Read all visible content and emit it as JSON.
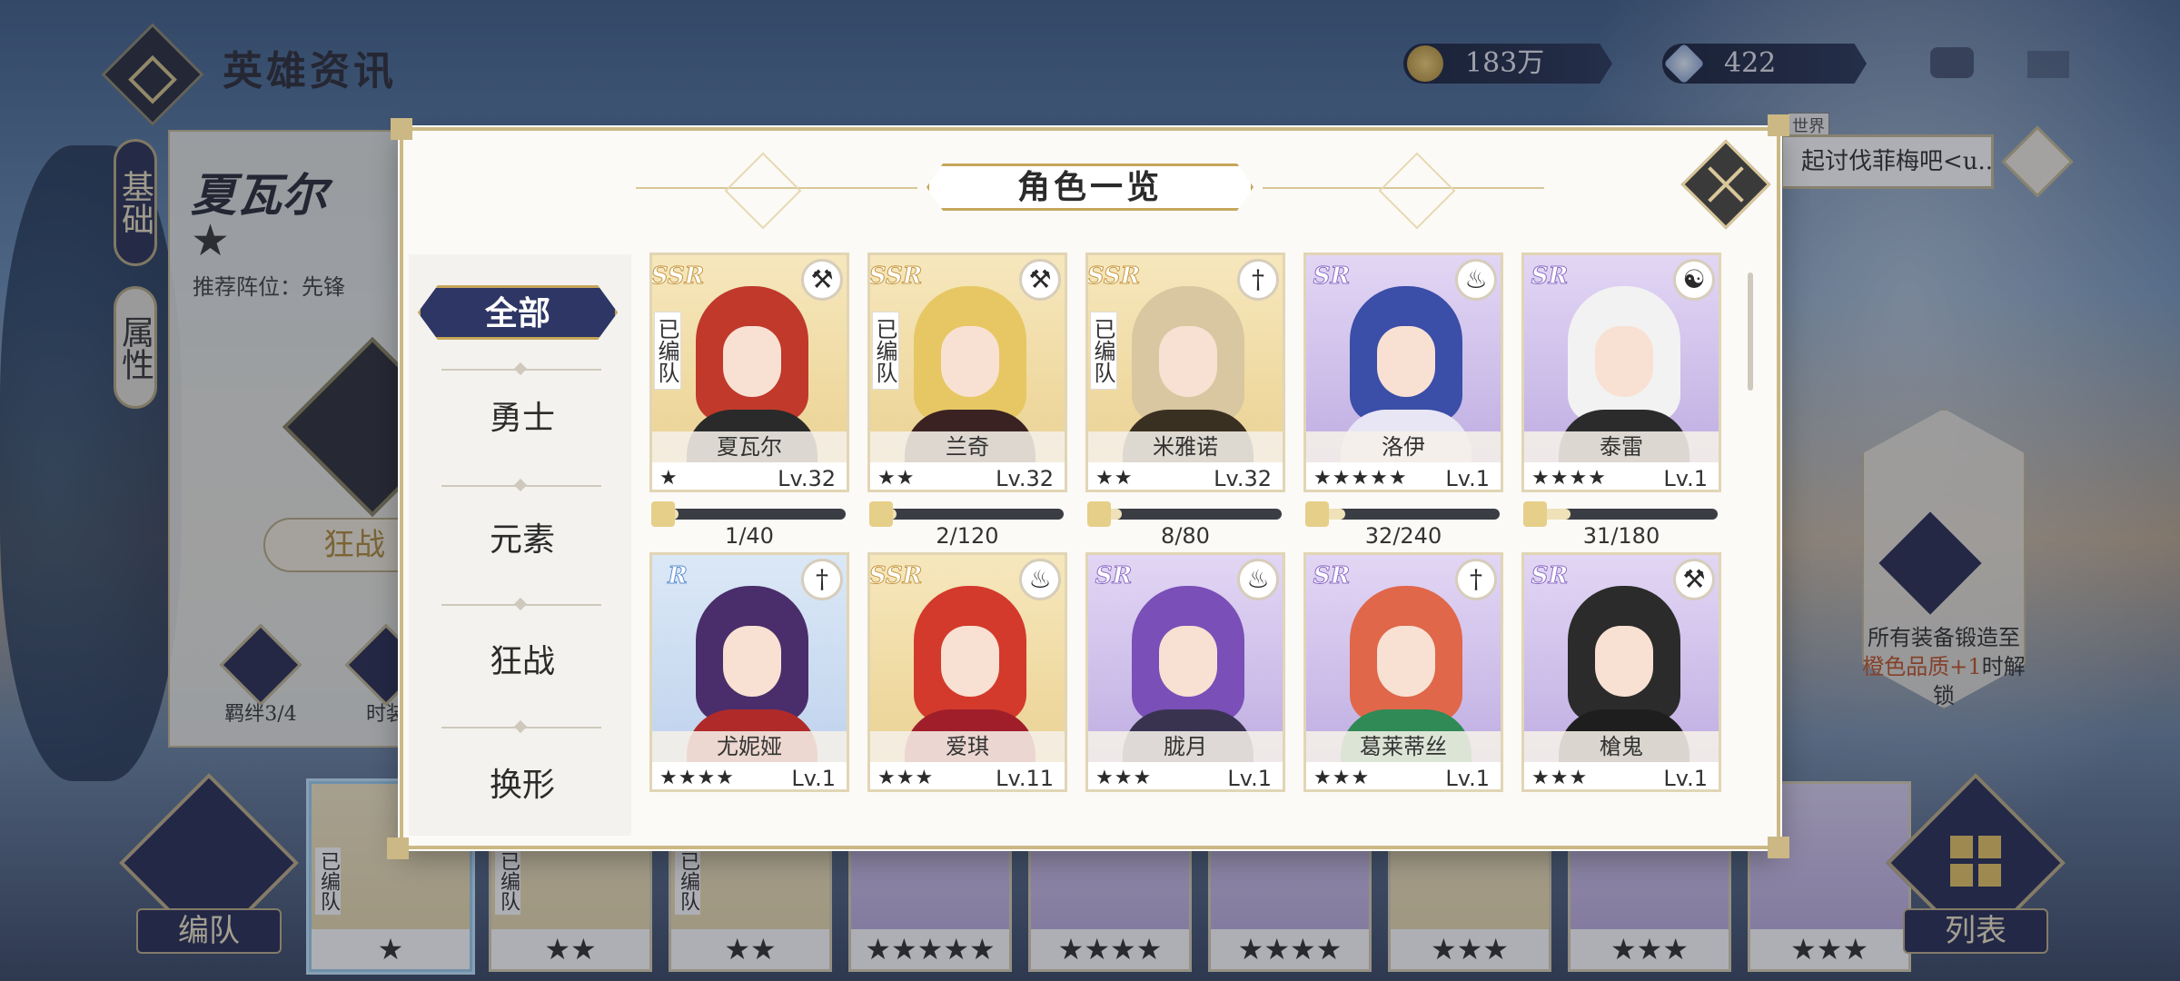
{
  "header": {
    "title": "英雄资讯",
    "gold": "183万",
    "gems": "422"
  },
  "hero_panel": {
    "name": "夏瓦尔",
    "stars": "★",
    "recommend": "推荐阵位：先锋",
    "tab_basic": "基础",
    "tab_attr": "属性",
    "class_tag": "狂战",
    "bond_label": "羁绊3/4",
    "dress_label": "时装"
  },
  "chat": {
    "world_tag": "世界",
    "message": "起讨伐菲梅吧<u..."
  },
  "lock": {
    "text_a": "所有装备锻造至",
    "text_b": "橙色品质+1",
    "text_c": "时解锁"
  },
  "bottom": {
    "team_label": "编队",
    "list_label": "列表",
    "strip": [
      {
        "stars": "★",
        "tag": "已编队",
        "rank": "ssr",
        "selected": true
      },
      {
        "stars": "★★",
        "tag": "已编队",
        "rank": "ssr"
      },
      {
        "stars": "★★",
        "tag": "已编队",
        "rank": "ssr"
      },
      {
        "stars": "★★★★★",
        "tag": "",
        "rank": "sr"
      },
      {
        "stars": "★★★★",
        "tag": "",
        "rank": "sr"
      },
      {
        "stars": "★★★★",
        "tag": "",
        "rank": "sr"
      },
      {
        "stars": "★★★",
        "tag": "",
        "rank": "ssr"
      },
      {
        "stars": "★★★",
        "tag": "",
        "rank": "sr"
      },
      {
        "stars": "★★★",
        "tag": "",
        "rank": "sr"
      }
    ]
  },
  "modal": {
    "title": "角色一览",
    "categories": [
      "全部",
      "勇士",
      "元素",
      "狂战",
      "换形"
    ],
    "active_category": "全部",
    "heroes": [
      {
        "name": "夏瓦尔",
        "rarity": "SSR",
        "stars": "★",
        "level": "Lv.32",
        "team": "已编队",
        "class_icon": "axe-icon",
        "progress": "1/40",
        "fill": 0.025,
        "hair": "#c0392b",
        "outfit": "#2a2a2a"
      },
      {
        "name": "兰奇",
        "rarity": "SSR",
        "stars": "★★",
        "level": "Lv.32",
        "team": "已编队",
        "class_icon": "axe-icon",
        "progress": "2/120",
        "fill": 0.017,
        "hair": "#e6c763",
        "outfit": "#3a2222"
      },
      {
        "name": "米雅诺",
        "rarity": "SSR",
        "stars": "★★",
        "level": "Lv.32",
        "team": "已编队",
        "class_icon": "sword-icon",
        "progress": "8/80",
        "fill": 0.1,
        "hair": "#d8c7a0",
        "outfit": "#3a3022"
      },
      {
        "name": "洛伊",
        "rarity": "SR",
        "stars": "★★★★★",
        "level": "Lv.1",
        "team": "",
        "class_icon": "flame-icon",
        "progress": "32/240",
        "fill": 0.133,
        "hair": "#3b4ea8",
        "outfit": "#e8e6f5"
      },
      {
        "name": "泰雷",
        "rarity": "SR",
        "stars": "★★★★",
        "level": "Lv.1",
        "team": "",
        "class_icon": "yin-yang-icon",
        "progress": "31/180",
        "fill": 0.172,
        "hair": "#f2f2f2",
        "outfit": "#2b2b2b"
      },
      {
        "name": "尤妮娅",
        "rarity": "R",
        "stars": "★★★★",
        "level": "Lv.1",
        "team": "",
        "class_icon": "sword-icon",
        "progress": "",
        "fill": 0,
        "hair": "#4a2e6b",
        "outfit": "#b02a2a"
      },
      {
        "name": "爱琪",
        "rarity": "SSR",
        "stars": "★★★",
        "level": "Lv.11",
        "team": "",
        "class_icon": "flame-icon",
        "progress": "",
        "fill": 0,
        "hair": "#d33a2c",
        "outfit": "#a01e2a"
      },
      {
        "name": "胧月",
        "rarity": "SR",
        "stars": "★★★",
        "level": "Lv.1",
        "team": "",
        "class_icon": "flame-icon",
        "progress": "",
        "fill": 0,
        "hair": "#7a4fb8",
        "outfit": "#3a3350"
      },
      {
        "name": "葛莱蒂丝",
        "rarity": "SR",
        "stars": "★★★",
        "level": "Lv.1",
        "team": "",
        "class_icon": "sword-icon",
        "progress": "",
        "fill": 0,
        "hair": "#e0674a",
        "outfit": "#2f8a55"
      },
      {
        "name": "槍鬼",
        "rarity": "SR",
        "stars": "★★★",
        "level": "Lv.1",
        "team": "",
        "class_icon": "axe-icon",
        "progress": "",
        "fill": 0,
        "hair": "#2b2b2b",
        "outfit": "#1e1e1e"
      }
    ]
  },
  "colors": {
    "accent_navy": "#2e3665",
    "gold_trim": "#cbb884"
  }
}
